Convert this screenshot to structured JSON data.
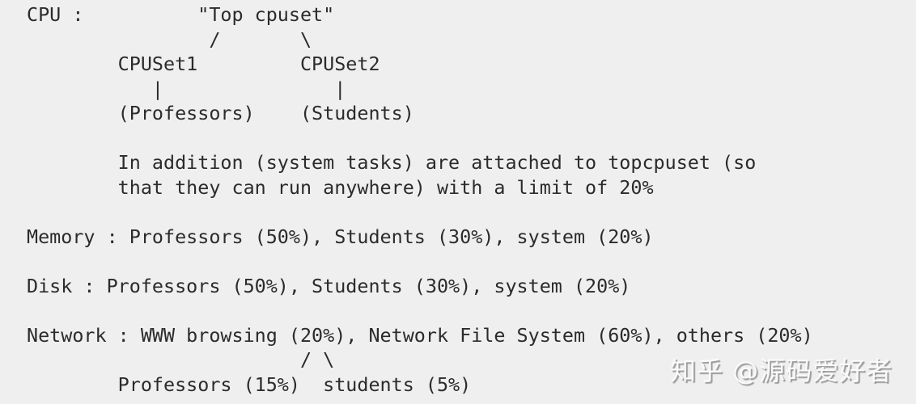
{
  "lines": [
    "CPU :          \"Top cpuset\"",
    "                /       \\",
    "        CPUSet1         CPUSet2",
    "           |               |",
    "        (Professors)    (Students)",
    "",
    "        In addition (system tasks) are attached to topcpuset (so",
    "        that they can run anywhere) with a limit of 20%",
    "",
    "Memory : Professors (50%), Students (30%), system (20%)",
    "",
    "Disk : Professors (50%), Students (30%), system (20%)",
    "",
    "Network : WWW browsing (20%), Network File System (60%), others (20%)",
    "                        / \\",
    "        Professors (15%)  students (5%)"
  ],
  "watermark": "知乎 @源码爱好者"
}
